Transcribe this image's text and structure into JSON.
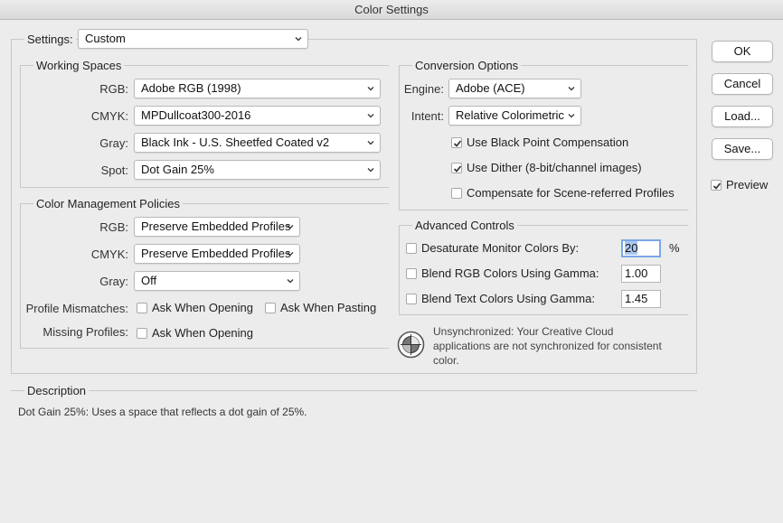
{
  "window": {
    "title": "Color Settings"
  },
  "settings": {
    "label": "Settings:",
    "value": "Custom"
  },
  "working_spaces": {
    "title": "Working Spaces",
    "rgb": {
      "label": "RGB:",
      "value": "Adobe RGB (1998)"
    },
    "cmyk": {
      "label": "CMYK:",
      "value": "MPDullcoat300-2016"
    },
    "gray": {
      "label": "Gray:",
      "value": "Black Ink - U.S. Sheetfed Coated v2"
    },
    "spot": {
      "label": "Spot:",
      "value": "Dot Gain 25%"
    }
  },
  "policies": {
    "title": "Color Management Policies",
    "rgb": {
      "label": "RGB:",
      "value": "Preserve Embedded Profiles"
    },
    "cmyk": {
      "label": "CMYK:",
      "value": "Preserve Embedded Profiles"
    },
    "gray": {
      "label": "Gray:",
      "value": "Off"
    },
    "profile_mismatches": {
      "label": "Profile Mismatches:",
      "ask_opening": {
        "label": "Ask When Opening",
        "checked": false
      },
      "ask_pasting": {
        "label": "Ask When Pasting",
        "checked": false
      }
    },
    "missing_profiles": {
      "label": "Missing Profiles:",
      "ask_opening": {
        "label": "Ask When Opening",
        "checked": false
      }
    }
  },
  "conversion": {
    "title": "Conversion Options",
    "engine": {
      "label": "Engine:",
      "value": "Adobe (ACE)"
    },
    "intent": {
      "label": "Intent:",
      "value": "Relative Colorimetric"
    },
    "black_point": {
      "label": "Use Black Point Compensation",
      "checked": true
    },
    "dither": {
      "label": "Use Dither (8-bit/channel images)",
      "checked": true
    },
    "scene_referred": {
      "label": "Compensate for Scene-referred Profiles",
      "checked": false
    }
  },
  "advanced": {
    "title": "Advanced Controls",
    "desaturate": {
      "label": "Desaturate Monitor Colors By:",
      "value": "20",
      "unit": "%",
      "checked": false
    },
    "blend_rgb": {
      "label": "Blend RGB Colors Using Gamma:",
      "value": "1.00",
      "checked": false
    },
    "blend_text": {
      "label": "Blend Text Colors Using Gamma:",
      "value": "1.45",
      "checked": false
    }
  },
  "sync_notice": {
    "icon": "color-sync-icon",
    "line1": "Unsynchronized: Your Creative Cloud",
    "line2": "applications are not synchronized for consistent",
    "line3": "color."
  },
  "description": {
    "title": "Description",
    "text": "Dot Gain 25%:  Uses a space that reflects a dot gain of 25%."
  },
  "buttons": {
    "ok": "OK",
    "cancel": "Cancel",
    "load": "Load...",
    "save": "Save..."
  },
  "preview": {
    "label": "Preview",
    "checked": true
  },
  "colors": {
    "focus_ring": "#7aa7e6",
    "selection": "#a9c8f0",
    "background": "#ececec"
  }
}
